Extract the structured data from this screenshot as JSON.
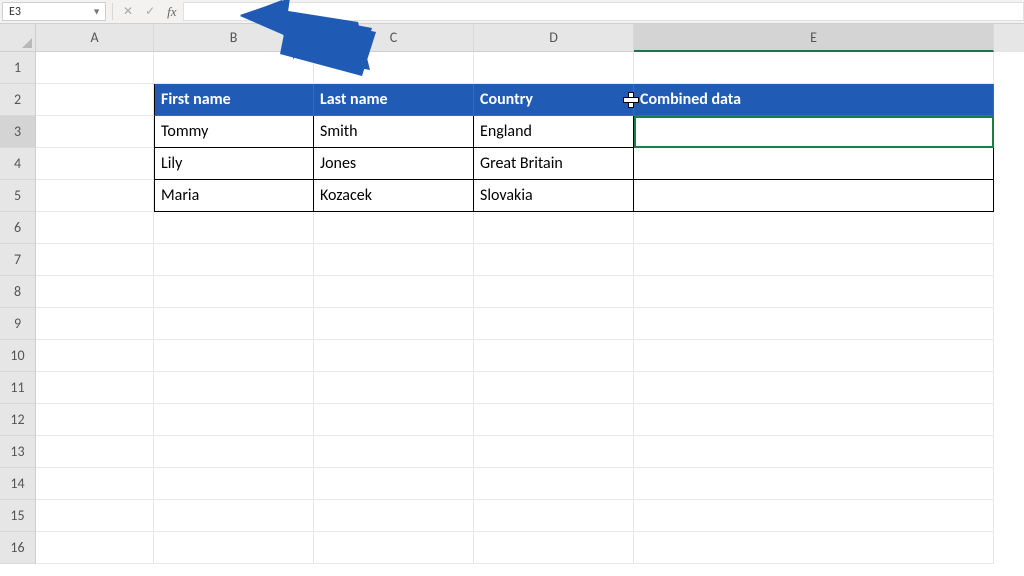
{
  "name_box": {
    "value": "E3"
  },
  "formula_input": {
    "value": ""
  },
  "colors": {
    "header_bg": "#205bb5",
    "header_fg": "#ffffff",
    "selection": "#1a7f47",
    "arrow": "#1f5bb5"
  },
  "columns": [
    "A",
    "B",
    "C",
    "D",
    "E"
  ],
  "rows": [
    "1",
    "2",
    "3",
    "4",
    "5",
    "6",
    "7",
    "8",
    "9",
    "10",
    "11",
    "12",
    "13",
    "14",
    "15",
    "16"
  ],
  "active": {
    "cell": "E3",
    "col": "E",
    "row": "3"
  },
  "table": {
    "headers": {
      "B": "First name",
      "C": "Last name",
      "D": "Country",
      "E": "Combined data"
    },
    "data": [
      {
        "B": "Tommy",
        "C": "Smith",
        "D": "England",
        "E": ""
      },
      {
        "B": "Lily",
        "C": "Jones",
        "D": "Great Britain",
        "E": ""
      },
      {
        "B": "Maria",
        "C": "Kozacek",
        "D": "Slovakia",
        "E": ""
      }
    ]
  },
  "icons": {
    "cancel": "✕",
    "enter": "✓",
    "fx": "fx",
    "dropdown": "▼"
  }
}
